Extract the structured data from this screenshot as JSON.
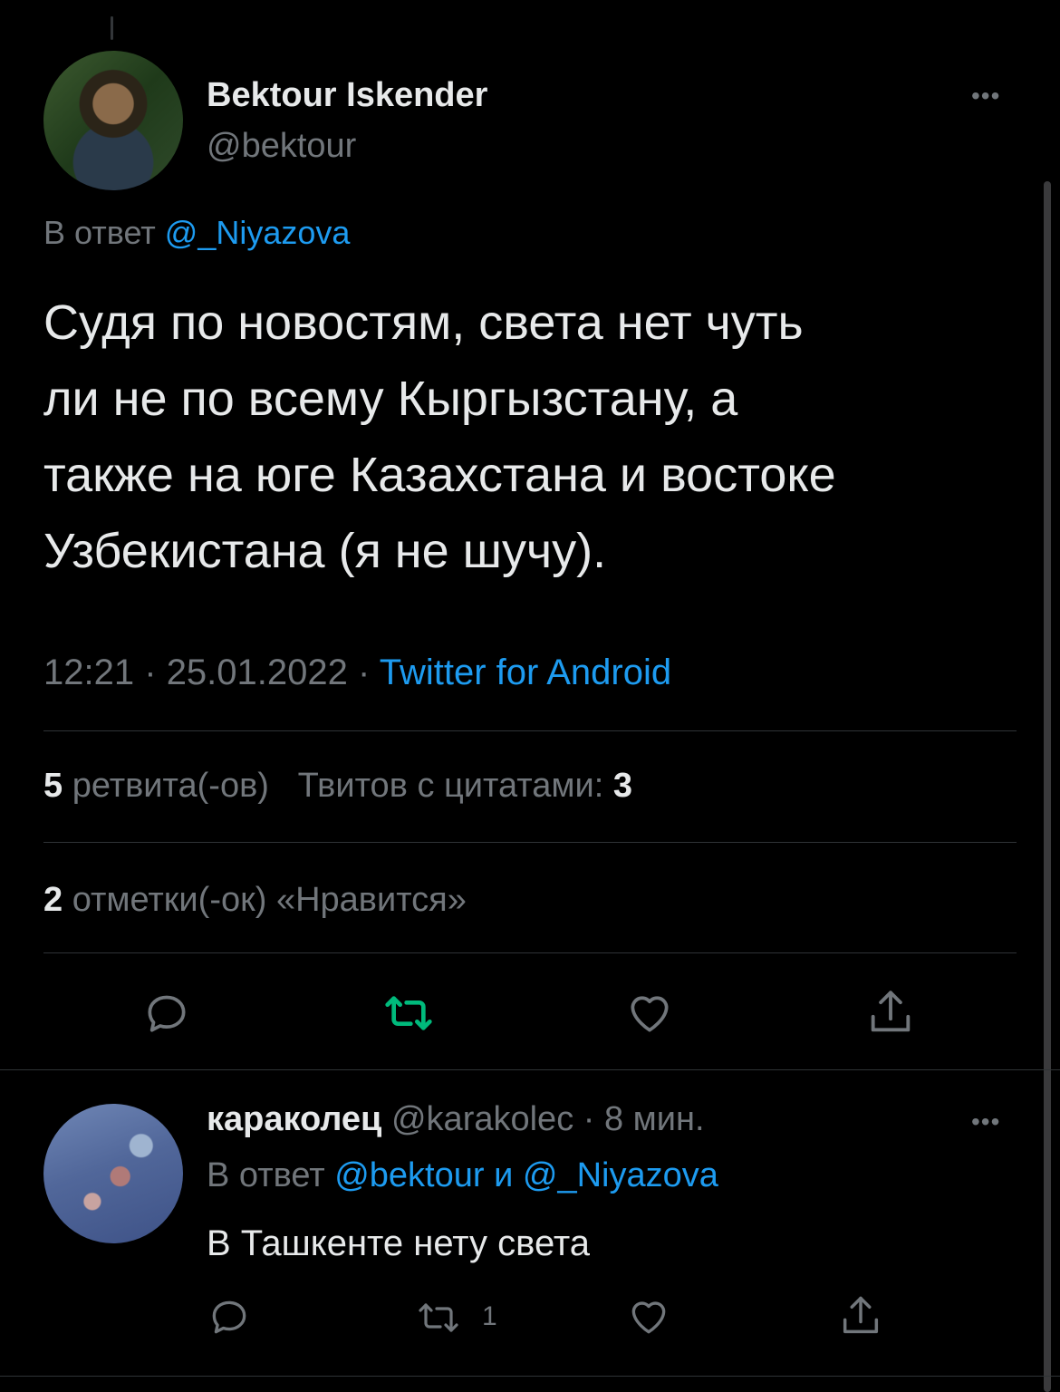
{
  "tweet": {
    "author_name": "Bektour Iskender",
    "author_handle": "@bektour",
    "replying_label": "В ответ",
    "replying_to": "@_Niyazova",
    "text": "Судя по новостям, света нет чуть\nли не по всему Кыргызстану, а\nтакже на юге Казахстана и востоке\nУзбекистана (я не шучу).",
    "time": "12:21",
    "date": "25.01.2022",
    "separator": "·",
    "source": "Twitter for Android",
    "retweets_count": "5",
    "retweets_label": "ретвита(-ов)",
    "quotes_label": "Твитов с цитатами:",
    "quotes_count": "3",
    "likes_count": "2",
    "likes_label": "отметки(-ок) «Нравится»",
    "more_icon": "•••"
  },
  "reply": {
    "author_name": "караколец",
    "author_handle": "@karakolec",
    "separator": "·",
    "time_ago": "8 мин.",
    "replying_label": "В ответ",
    "replying_to_1": "@bektour",
    "conjunction": "и",
    "replying_to_2": "@_Niyazova",
    "text": "В Ташкенте нету света",
    "retweet_count": "1",
    "more_icon": "•••"
  },
  "colors": {
    "background": "#000000",
    "text": "#e7e9ea",
    "muted": "#71767b",
    "link": "#1d9bf0",
    "retweet_active": "#00ba7c",
    "divider": "#2f3336"
  },
  "icons": [
    "reply-icon",
    "retweet-icon",
    "like-icon",
    "share-icon",
    "more-icon"
  ]
}
